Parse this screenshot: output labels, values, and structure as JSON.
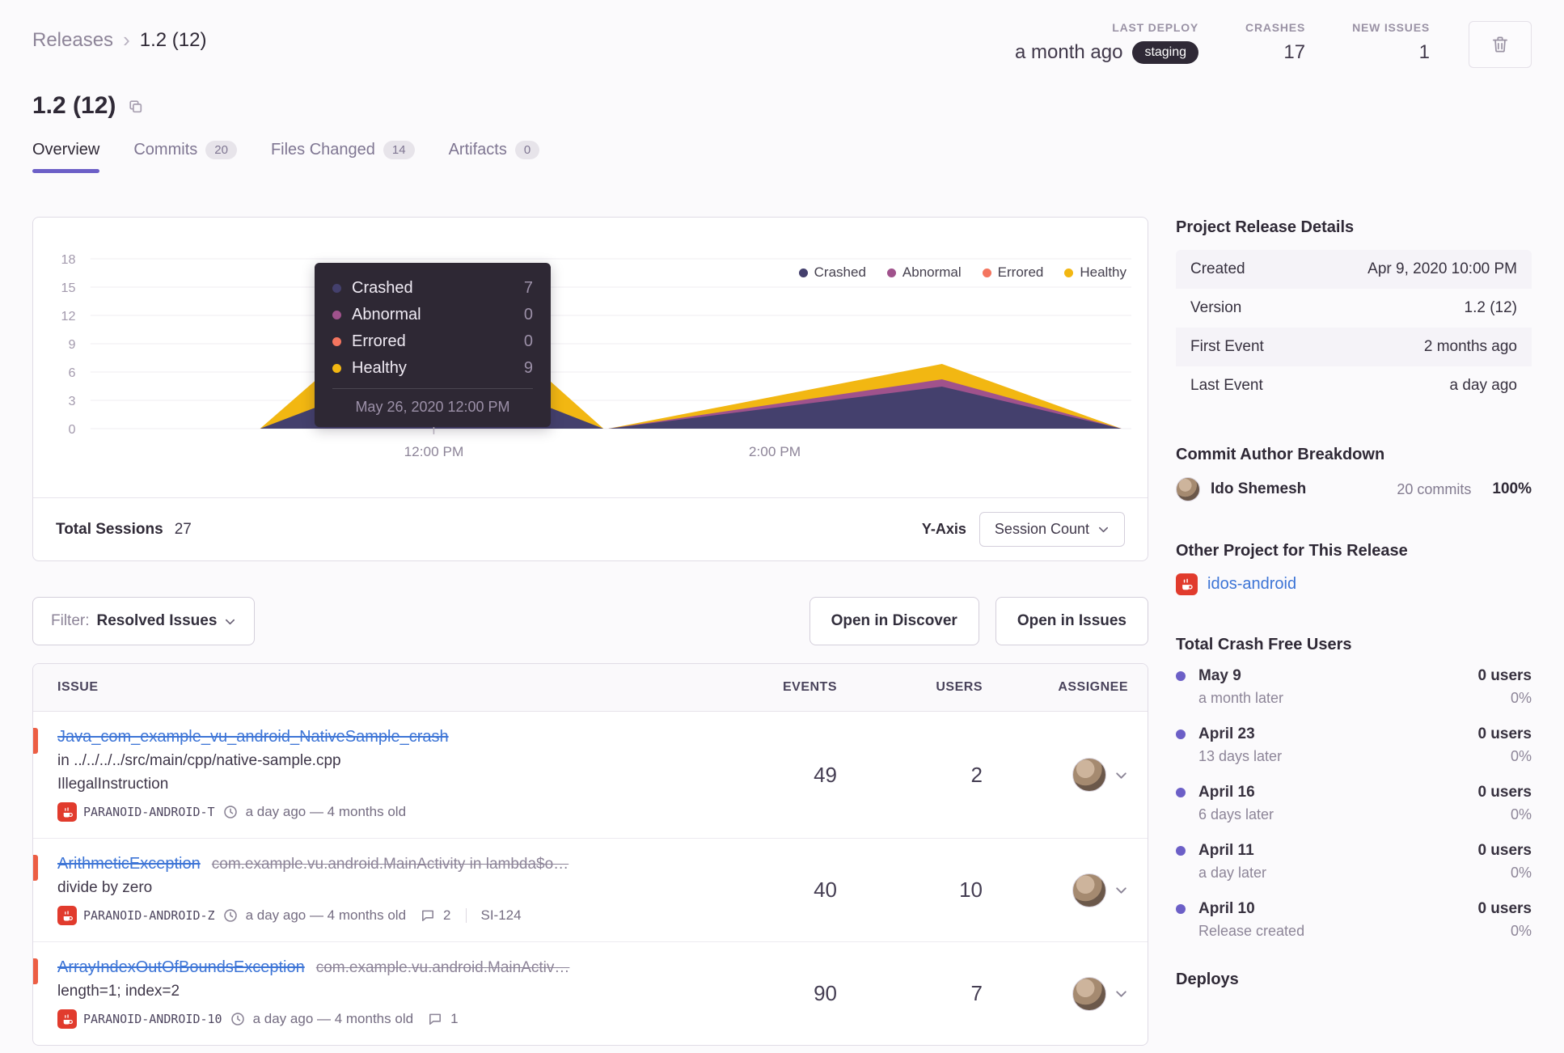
{
  "colors": {
    "accent": "#6c5fc7",
    "link": "#3c74d6",
    "error": "#ec5e44",
    "java_red": "#e13b2d",
    "badge_dark": "#2f2936"
  },
  "breadcrumb": {
    "root": "Releases",
    "current": "1.2 (12)"
  },
  "header_stats": [
    {
      "label": "LAST DEPLOY",
      "value": "a month ago",
      "badge": "staging"
    },
    {
      "label": "CRASHES",
      "value": "17"
    },
    {
      "label": "NEW ISSUES",
      "value": "1"
    }
  ],
  "page_title": "1.2 (12)",
  "tabs": [
    {
      "label": "Overview"
    },
    {
      "label": "Commits",
      "count": "20"
    },
    {
      "label": "Files Changed",
      "count": "14"
    },
    {
      "label": "Artifacts",
      "count": "0"
    }
  ],
  "chart_data": {
    "type": "area",
    "stacked": true,
    "legend_position": "top-right",
    "y_ticks": [
      "18",
      "15",
      "12",
      "9",
      "6",
      "3",
      "0"
    ],
    "x_ticks": [
      "12:00 PM",
      "2:00 PM"
    ],
    "series": [
      {
        "name": "Crashed",
        "color": "#44406d",
        "points": [
          {
            "x": "12:00 PM",
            "y": 7
          },
          {
            "x": "2:30 PM",
            "y": 5
          }
        ]
      },
      {
        "name": "Abnormal",
        "color": "#a0528c",
        "points": [
          {
            "x": "12:00 PM",
            "y": 0
          },
          {
            "x": "2:30 PM",
            "y": 1
          }
        ]
      },
      {
        "name": "Errored",
        "color": "#f4755f",
        "points": [
          {
            "x": "12:00 PM",
            "y": 0
          },
          {
            "x": "2:30 PM",
            "y": 0
          }
        ]
      },
      {
        "name": "Healthy",
        "color": "#f2b712",
        "points": [
          {
            "x": "12:00 PM",
            "y": 9
          },
          {
            "x": "2:30 PM",
            "y": 2
          }
        ]
      }
    ],
    "tooltip": {
      "rows": [
        {
          "label": "Crashed",
          "value": "7"
        },
        {
          "label": "Abnormal",
          "value": "0"
        },
        {
          "label": "Errored",
          "value": "0"
        },
        {
          "label": "Healthy",
          "value": "9"
        }
      ],
      "date": "May 26, 2020 12:00 PM"
    },
    "footer": {
      "total_label": "Total Sessions",
      "total_value": "27",
      "yaxis_label": "Y-Axis",
      "yaxis_value": "Session Count"
    }
  },
  "controls": {
    "filter_label": "Filter:",
    "filter_value": "Resolved Issues",
    "open_discover": "Open in Discover",
    "open_issues": "Open in Issues"
  },
  "issues": {
    "columns": {
      "issue": "ISSUE",
      "events": "EVENTS",
      "users": "USERS",
      "assignee": "ASSIGNEE"
    },
    "rows": [
      {
        "title": "Java_com_example_vu_android_NativeSample_crash",
        "culprit": "in ../../../../src/main/cpp/native-sample.cpp",
        "message": "IllegalInstruction",
        "project": "PARANOID-ANDROID-T",
        "age": "a day ago — 4 months old",
        "events": "49",
        "users": "2"
      },
      {
        "title": "ArithmeticException",
        "subtitle": "com.example.vu.android.MainActivity in lambda$o…",
        "message": "divide by zero",
        "project": "PARANOID-ANDROID-Z",
        "age": "a day ago — 4 months old",
        "comments": "2",
        "short_id": "SI-124",
        "events": "40",
        "users": "10"
      },
      {
        "title": "ArrayIndexOutOfBoundsException",
        "subtitle": "com.example.vu.android.MainActiv…",
        "message": "length=1; index=2",
        "project": "PARANOID-ANDROID-10",
        "age": "a day ago — 4 months old",
        "comments": "1",
        "events": "90",
        "users": "7"
      }
    ]
  },
  "sidebar": {
    "details": {
      "title": "Project Release Details",
      "rows": [
        {
          "label": "Created",
          "value": "Apr 9, 2020 10:00 PM"
        },
        {
          "label": "Version",
          "value": "1.2 (12)"
        },
        {
          "label": "First Event",
          "value": "2 months ago"
        },
        {
          "label": "Last Event",
          "value": "a day ago"
        }
      ]
    },
    "commit_authors": {
      "title": "Commit Author Breakdown",
      "authors": [
        {
          "name": "Ido Shemesh",
          "commits": "20 commits",
          "percent": "100%"
        }
      ]
    },
    "other_project": {
      "title": "Other Project for This Release",
      "project": "idos-android"
    },
    "crash_free": {
      "title": "Total Crash Free Users",
      "items": [
        {
          "date": "May 9",
          "sub": "a month later",
          "users": "0 users",
          "percent": "0%"
        },
        {
          "date": "April 23",
          "sub": "13 days later",
          "users": "0 users",
          "percent": "0%"
        },
        {
          "date": "April 16",
          "sub": "6 days later",
          "users": "0 users",
          "percent": "0%"
        },
        {
          "date": "April 11",
          "sub": "a day later",
          "users": "0 users",
          "percent": "0%"
        },
        {
          "date": "April 10",
          "sub": "Release created",
          "users": "0 users",
          "percent": "0%"
        }
      ]
    },
    "deploys_title": "Deploys"
  }
}
